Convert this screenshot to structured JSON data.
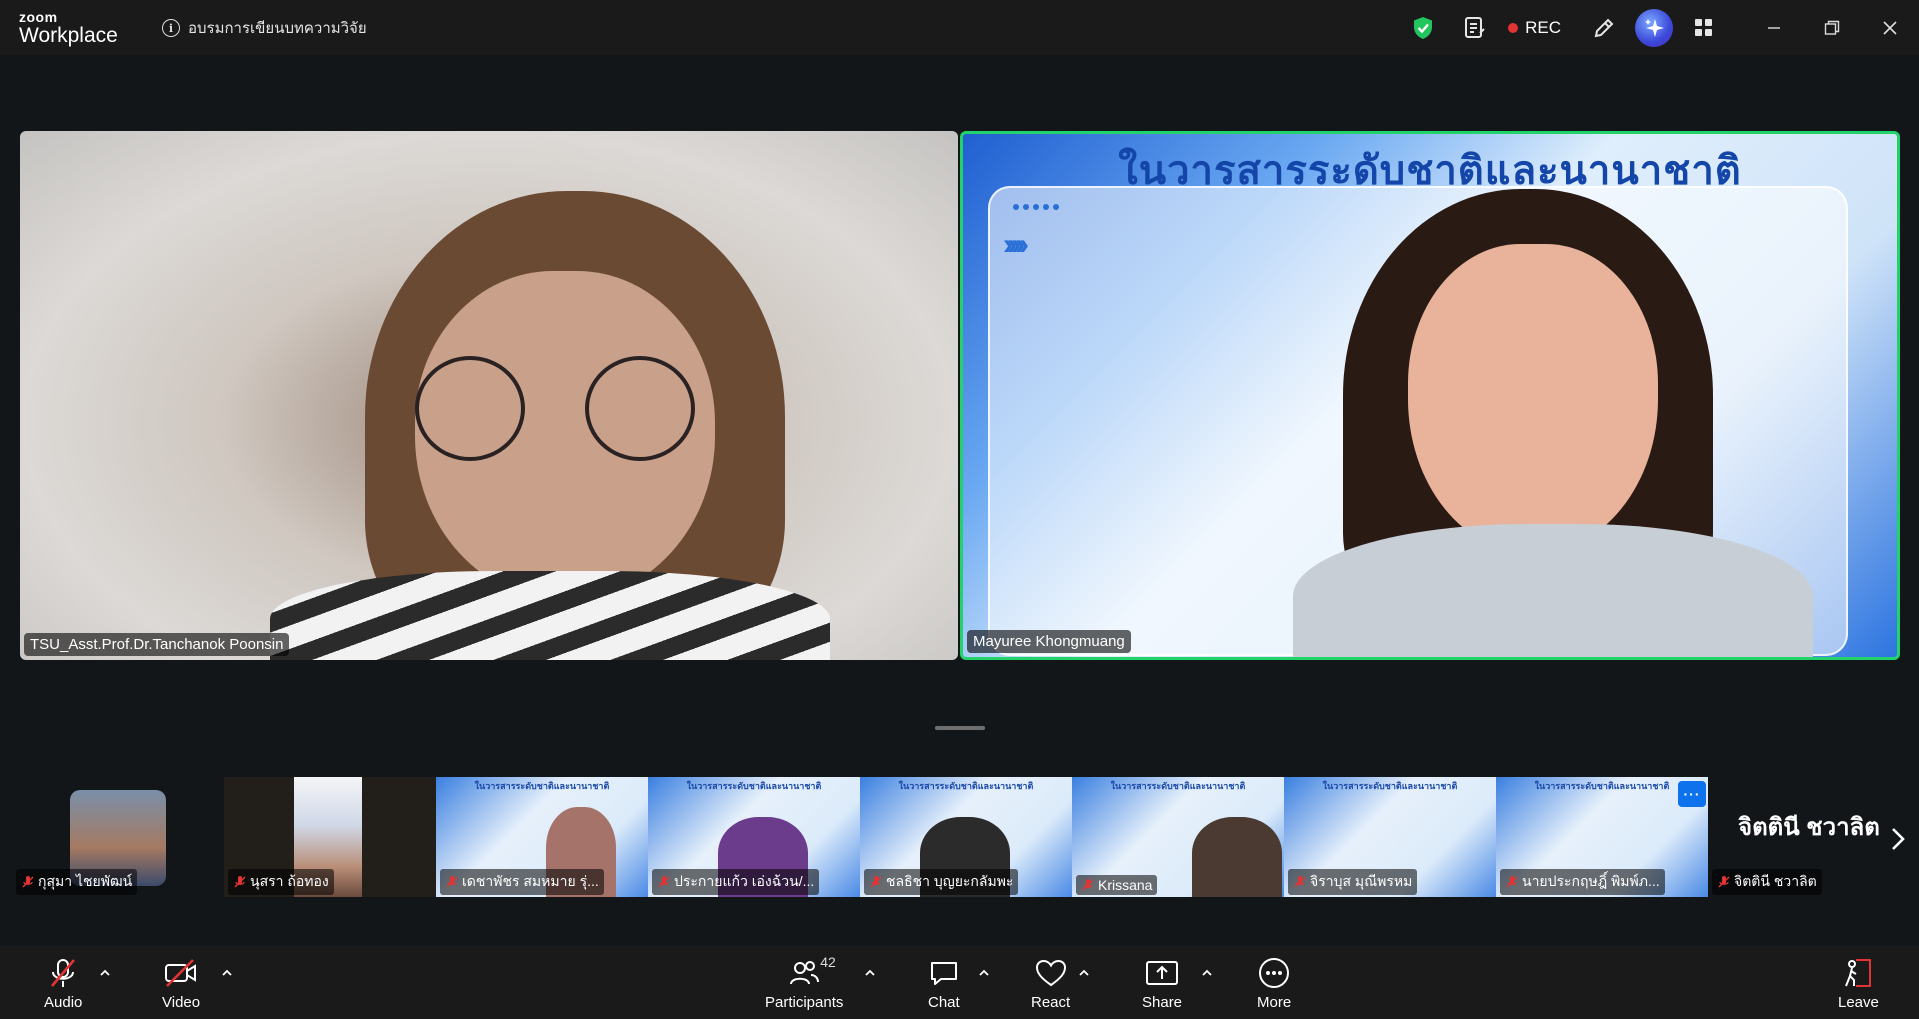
{
  "app": {
    "logo_small": "zoom",
    "logo_large": "Workplace",
    "meeting_title": "อบรมการเขียนบทความวิจัย",
    "rec_label": "REC"
  },
  "colors": {
    "active_speaker_border": "#22d36b",
    "rec_dot": "#e23434",
    "toolbar_bg": "#1a1a1a",
    "accent_blue": "#0e72ed"
  },
  "videos": [
    {
      "name": "TSU_Asst.Prof.Dr.Tanchanok Poonsin"
    },
    {
      "name": "Mayuree Khongmuang",
      "slide_title": "ในวารสารระดับชาติและนานาชาติ",
      "active_speaker": true
    }
  ],
  "thumbnails": [
    {
      "name": "กุสุมา ไชยพัฒน์",
      "muted": true
    },
    {
      "name": "นุสรา ถ้อทอง",
      "muted": true
    },
    {
      "name": "เดชาพัชร สมหมาย รุ่...",
      "muted": true
    },
    {
      "name": "ประกายแก้ว เอ่งฉ้วน/...",
      "muted": true
    },
    {
      "name": "ชลธิชา บุญยะกลัมพะ",
      "muted": true
    },
    {
      "name": "Krissana",
      "muted": true
    },
    {
      "name": "จิราบุส มุณีพรหม",
      "muted": true
    },
    {
      "name": "นายประกฤษฎิ์ พิมพ์ภ...",
      "muted": true
    },
    {
      "name": "จิตตินี ชวาลิต",
      "muted": true,
      "display_name": "จิตตินี ชวาลิต"
    }
  ],
  "thumb_slide_title": "ในวารสารระดับชาติและนานาชาติ",
  "thumb_more": "···",
  "toolbar": {
    "audio": "Audio",
    "video": "Video",
    "participants": "Participants",
    "participants_count": "42",
    "chat": "Chat",
    "react": "React",
    "share": "Share",
    "more": "More",
    "leave": "Leave"
  }
}
